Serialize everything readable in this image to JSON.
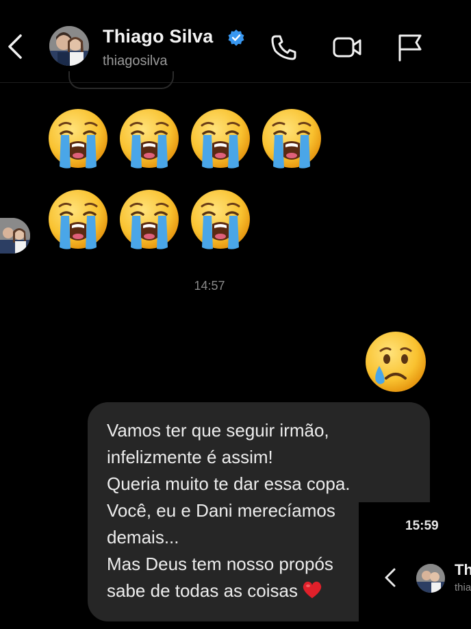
{
  "header": {
    "name": "Thiago Silva",
    "handle": "thiagosilva",
    "verified": true,
    "icons": [
      "back-arrow-icon",
      "verified-badge-icon",
      "phone-icon",
      "video-camera-icon",
      "flag-icon"
    ]
  },
  "messages": {
    "incoming_emojis": [
      "😭",
      "😭",
      "😭",
      "😭",
      "😭",
      "😭",
      "😭"
    ],
    "timestamp": "14:57",
    "outgoing_emoji": "😢",
    "text_lines": [
      "Vamos ter que seguir irmão,",
      "infelizmente é assim!",
      "Queria muito te dar essa copa.",
      "Você, eu e Dani merecíamos",
      "demais...",
      "Mas Deus tem nosso propós",
      "sabe de todas as coisas"
    ],
    "heart": "❤️"
  },
  "overlay": {
    "time": "15:59",
    "name": "Th",
    "handle": "thia"
  },
  "colors": {
    "background": "#000000",
    "bubble": "#262626",
    "verified": "#3897f0",
    "emoji_face": "#f9c230",
    "tears": "#4aa6e8",
    "heart": "#e0202a"
  }
}
